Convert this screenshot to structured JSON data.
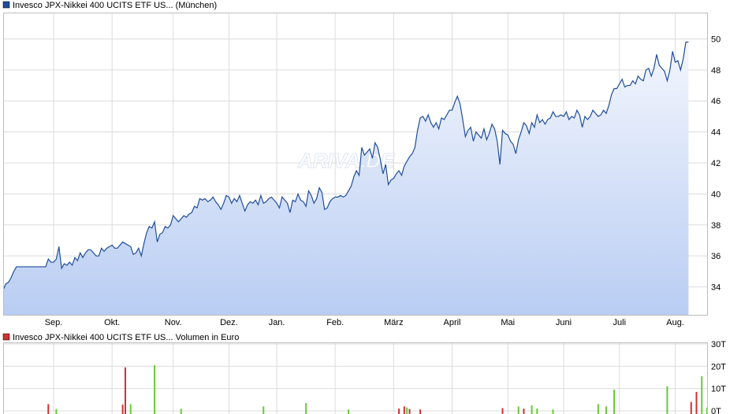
{
  "colors": {
    "price_line": "#1f4e9c",
    "price_fill_top": "#f3f6fd",
    "price_fill_bottom": "#b9cdf3",
    "grid": "#dcdcdc",
    "frame": "#bdbdbd",
    "volume_up": "#66cc33",
    "volume_down": "#cc3333",
    "legend_price_box": "#1f4e9c",
    "legend_volume_box": "#cc3333"
  },
  "watermark": "ARIVA.DE",
  "chart_data": [
    {
      "type": "area",
      "legend": "Invesco JPX-Nikkei 400 UCITS ETF US... (München)",
      "x_tick_labels": [
        "Sep.",
        "Okt.",
        "Nov.",
        "Dez.",
        "Jan.",
        "Feb.",
        "März",
        "April",
        "Mai",
        "Juni",
        "Juli",
        "Aug."
      ],
      "x_tick_positions": [
        19,
        41,
        64,
        85,
        103,
        125,
        147,
        169,
        190,
        211,
        232,
        253
      ],
      "y_tick_labels": [
        "34",
        "36",
        "38",
        "40",
        "42",
        "44",
        "46",
        "48",
        "50"
      ],
      "y_tick_values": [
        34,
        36,
        38,
        40,
        42,
        44,
        46,
        48,
        50
      ],
      "ylim": [
        32.2,
        51.7
      ],
      "x_count": 266,
      "grid": true,
      "values": [
        33.8,
        34.2,
        34.3,
        34.6,
        35.0,
        35.3,
        35.3,
        35.3,
        35.3,
        35.3,
        35.3,
        35.3,
        35.3,
        35.3,
        35.3,
        35.3,
        35.3,
        35.8,
        35.6,
        35.6,
        35.8,
        36.6,
        35.2,
        35.5,
        35.4,
        35.6,
        35.4,
        35.9,
        35.7,
        36.2,
        35.9,
        36.2,
        36.4,
        36.4,
        36.2,
        36.0,
        36.0,
        36.5,
        36.3,
        36.5,
        36.6,
        36.7,
        36.5,
        36.5,
        36.7,
        36.9,
        36.8,
        36.7,
        36.6,
        36.1,
        36.2,
        36.5,
        36.0,
        36.8,
        37.5,
        37.9,
        37.8,
        38.2,
        36.9,
        37.4,
        37.5,
        37.9,
        37.8,
        38.0,
        38.6,
        38.4,
        38.2,
        38.4,
        38.6,
        38.5,
        38.7,
        38.8,
        39.2,
        39.1,
        39.7,
        39.6,
        39.7,
        39.5,
        39.6,
        39.8,
        39.5,
        39.3,
        39.0,
        39.4,
        39.9,
        39.8,
        39.4,
        39.7,
        39.5,
        39.9,
        39.4,
        38.9,
        39.3,
        39.5,
        39.4,
        39.6,
        39.3,
        39.9,
        39.4,
        39.5,
        39.7,
        39.8,
        39.6,
        39.4,
        39.1,
        39.8,
        39.6,
        39.4,
        38.8,
        39.6,
        39.5,
        40.0,
        39.6,
        39.5,
        39.2,
        40.2,
        39.9,
        39.4,
        39.7,
        40.4,
        40.1,
        39.0,
        39.1,
        39.5,
        39.7,
        39.8,
        39.8,
        39.9,
        39.8,
        39.9,
        40.2,
        40.5,
        41.1,
        41.5,
        41.2,
        43.0,
        42.5,
        42.7,
        42.9,
        42.3,
        43.3,
        43.0,
        42.2,
        41.3,
        41.9,
        40.6,
        40.9,
        41.0,
        41.3,
        41.5,
        41.2,
        41.8,
        42.1,
        42.4,
        42.6,
        43.0,
        44.1,
        44.9,
        45.0,
        44.7,
        45.1,
        44.6,
        44.3,
        44.6,
        44.2,
        44.9,
        44.8,
        45.1,
        45.4,
        45.4,
        45.9,
        46.3,
        45.8,
        44.8,
        43.7,
        44.1,
        44.3,
        43.4,
        44.0,
        43.8,
        43.6,
        44.2,
        43.5,
        43.9,
        44.5,
        44.2,
        43.4,
        41.9,
        44.1,
        43.9,
        43.8,
        43.4,
        43.2,
        42.6,
        43.5,
        44.0,
        44.6,
        44.4,
        43.9,
        44.6,
        44.3,
        45.1,
        44.6,
        44.8,
        44.5,
        44.8,
        44.9,
        45.3,
        45.0,
        45.0,
        45.1,
        45.0,
        45.3,
        44.8,
        45.0,
        44.9,
        45.4,
        45.1,
        44.3,
        45.0,
        44.8,
        45.0,
        45.4,
        45.2,
        45.0,
        45.1,
        45.4,
        45.2,
        45.7,
        46.4,
        46.8,
        46.8,
        47.1,
        47.4,
        46.9,
        47.0,
        47.0,
        47.3,
        47.1,
        47.6,
        47.4,
        47.3,
        48.0,
        48.1,
        47.6,
        48.1,
        49.0,
        48.3,
        48.1,
        47.9,
        47.3,
        48.0,
        49.2,
        48.5,
        48.6,
        48.0,
        48.7,
        49.8,
        49.8
      ]
    },
    {
      "type": "bar",
      "legend": "Invesco JPX-Nikkei 400 UCITS ETF US... Volumen in Euro",
      "x_tick_labels": [],
      "y_tick_labels": [
        "0T",
        "10T",
        "20T",
        "30T"
      ],
      "y_tick_values": [
        0,
        10,
        20,
        30
      ],
      "ylim": [
        0,
        30
      ],
      "x_count": 266,
      "grid": true,
      "bars": [
        {
          "i": 17,
          "v": 3.0,
          "dir": "down"
        },
        {
          "i": 20,
          "v": 0.8,
          "dir": "up"
        },
        {
          "i": 45,
          "v": 2.8,
          "dir": "down"
        },
        {
          "i": 46,
          "v": 19.5,
          "dir": "down"
        },
        {
          "i": 48,
          "v": 3.0,
          "dir": "up"
        },
        {
          "i": 57,
          "v": 20.5,
          "dir": "up"
        },
        {
          "i": 67,
          "v": 0.9,
          "dir": "up"
        },
        {
          "i": 98,
          "v": 2.0,
          "dir": "up"
        },
        {
          "i": 114,
          "v": 3.5,
          "dir": "up"
        },
        {
          "i": 130,
          "v": 0.6,
          "dir": "up"
        },
        {
          "i": 149,
          "v": 1.0,
          "dir": "down"
        },
        {
          "i": 151,
          "v": 2.0,
          "dir": "down"
        },
        {
          "i": 152,
          "v": 1.5,
          "dir": "up"
        },
        {
          "i": 153,
          "v": 0.8,
          "dir": "down"
        },
        {
          "i": 157,
          "v": 0.6,
          "dir": "down"
        },
        {
          "i": 188,
          "v": 1.2,
          "dir": "down"
        },
        {
          "i": 194,
          "v": 2.0,
          "dir": "up"
        },
        {
          "i": 196,
          "v": 1.0,
          "dir": "down"
        },
        {
          "i": 199,
          "v": 2.5,
          "dir": "up"
        },
        {
          "i": 201,
          "v": 1.0,
          "dir": "up"
        },
        {
          "i": 207,
          "v": 0.6,
          "dir": "up"
        },
        {
          "i": 224,
          "v": 3.0,
          "dir": "up"
        },
        {
          "i": 227,
          "v": 2.0,
          "dir": "up"
        },
        {
          "i": 230,
          "v": 9.5,
          "dir": "up"
        },
        {
          "i": 250,
          "v": 11.0,
          "dir": "up"
        },
        {
          "i": 259,
          "v": 4.0,
          "dir": "down"
        },
        {
          "i": 261,
          "v": 8.5,
          "dir": "down"
        },
        {
          "i": 263,
          "v": 15.5,
          "dir": "up"
        },
        {
          "i": 265,
          "v": 1.5,
          "dir": "up"
        }
      ]
    }
  ]
}
